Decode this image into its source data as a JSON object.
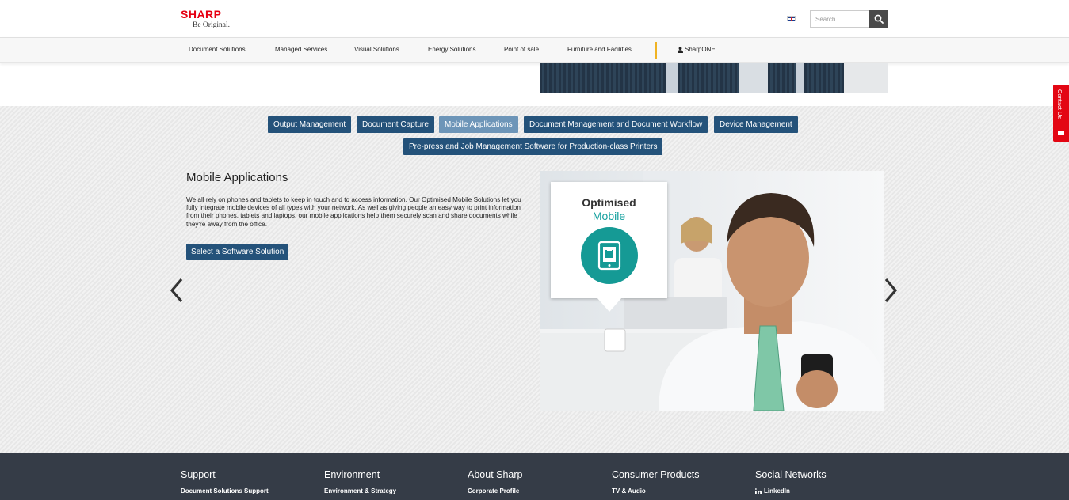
{
  "header": {
    "logo_text": "SHARP",
    "logo_tagline": "Be Original.",
    "search": {
      "placeholder": "Search..."
    }
  },
  "nav": {
    "items": [
      "Document Solutions",
      "Managed Services",
      "Visual Solutions",
      "Energy Solutions",
      "Point of sale",
      "Furniture and Facilities"
    ],
    "sharpone_label": "SharpONE"
  },
  "tabs": {
    "row1": [
      "Output Management",
      "Document Capture",
      "Mobile Applications",
      "Document Management and Document Workflow",
      "Device Management"
    ],
    "row2": [
      "Pre-press and Job Management Software for Production-class Printers"
    ],
    "active": "Mobile Applications"
  },
  "section": {
    "title": "Mobile Applications",
    "description": "We all rely on phones and tablets to keep in touch and to access information. Our Optimised Mobile Solutions let you fully integrate mobile devices of all types with your network. As well as giving people an easy way to print information from their phones, tablets and laptops, our mobile applications help them securely scan and share documents while they're away from the office.",
    "cta_label": "Select a Software Solution"
  },
  "feature": {
    "callout_title": "Optimised",
    "callout_subtitle": "Mobile",
    "icon": "tablet-icon"
  },
  "contact_tab": {
    "label": "Contact Us"
  },
  "footer": {
    "columns": [
      {
        "heading": "Support",
        "link": "Document Solutions Support"
      },
      {
        "heading": "Environment",
        "link": "Environment & Strategy"
      },
      {
        "heading": "About Sharp",
        "link": "Corporate Profile"
      },
      {
        "heading": "Consumer Products",
        "link": "TV & Audio"
      },
      {
        "heading": "Social Networks",
        "link": "LinkedIn"
      }
    ]
  },
  "colors": {
    "brand_red": "#e60012",
    "tab_blue": "#24527a",
    "tab_active": "#6d95b8",
    "teal": "#159a95",
    "footer_bg": "#353c47",
    "nav_divider": "#f0b323"
  }
}
